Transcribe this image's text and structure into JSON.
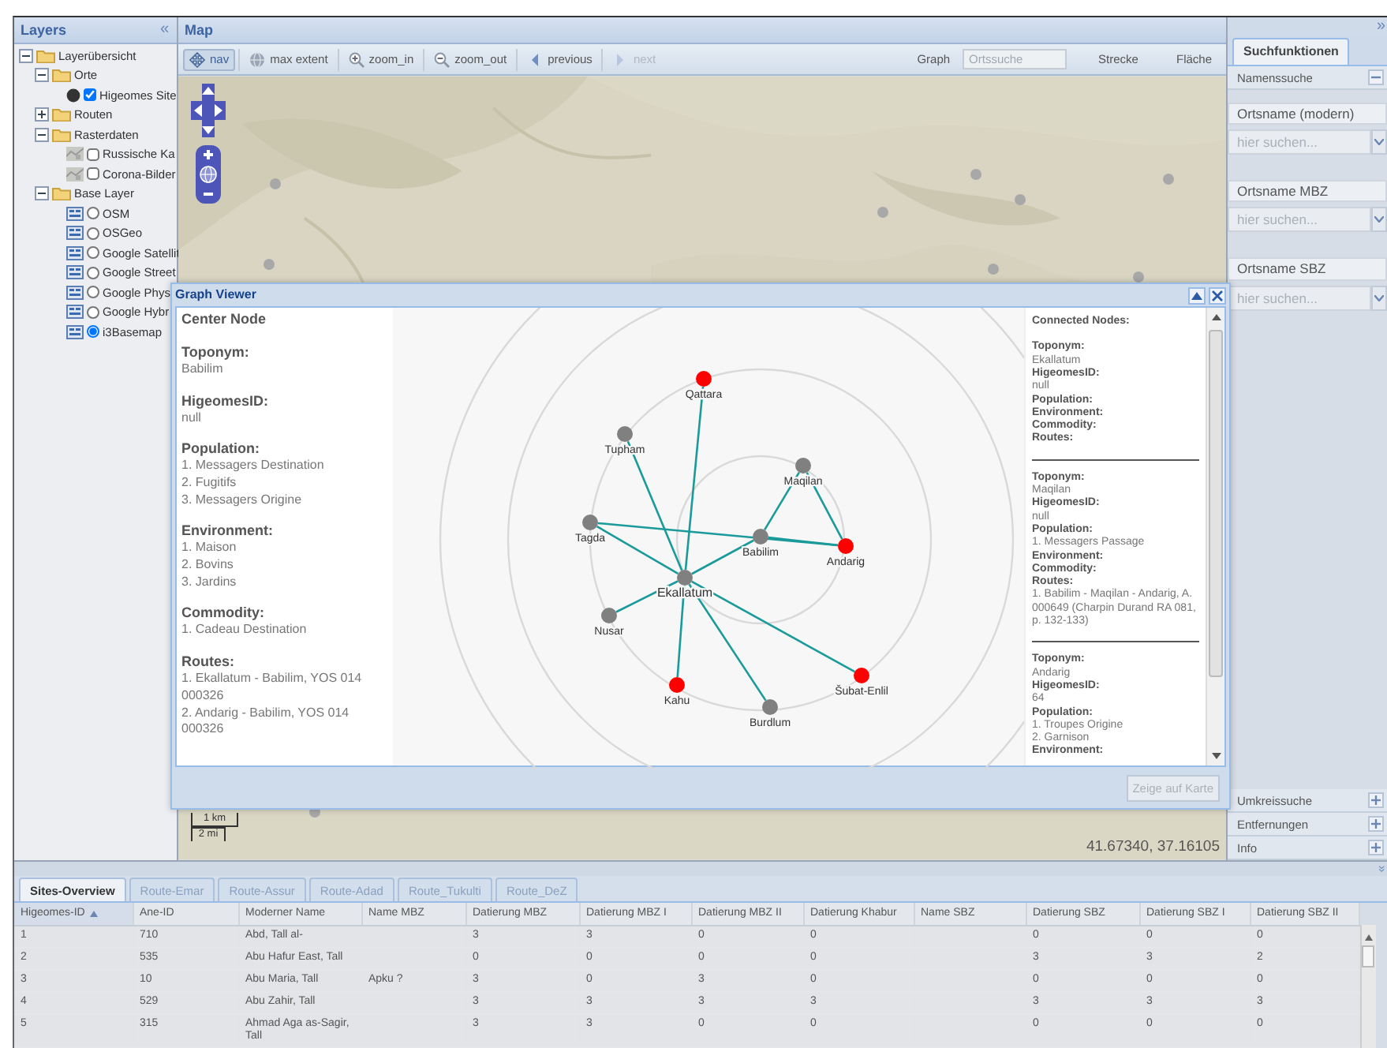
{
  "layers_panel": {
    "title": "Layers",
    "collapse_icon": "«",
    "tree": [
      {
        "label": "Layerübersicht",
        "kind": "folder",
        "expanded": true,
        "children": [
          {
            "label": "Orte",
            "kind": "folder",
            "expanded": true,
            "children": [
              {
                "label": "Higeomes Site",
                "kind": "point-layer",
                "checked": true
              }
            ]
          },
          {
            "label": "Routen",
            "kind": "folder",
            "expanded": false
          },
          {
            "label": "Rasterdaten",
            "kind": "folder",
            "expanded": true,
            "children": [
              {
                "label": "Russische Ka",
                "kind": "raster-layer",
                "checked": false
              },
              {
                "label": "Corona-Bilder",
                "kind": "raster-layer",
                "checked": false
              }
            ]
          },
          {
            "label": "Base Layer",
            "kind": "folder",
            "expanded": true,
            "children": [
              {
                "label": "OSM",
                "kind": "base-layer",
                "selected": false
              },
              {
                "label": "OSGeo",
                "kind": "base-layer",
                "selected": false
              },
              {
                "label": "Google Satellit",
                "kind": "base-layer",
                "selected": false
              },
              {
                "label": "Google Street",
                "kind": "base-layer",
                "selected": false
              },
              {
                "label": "Google Phys",
                "kind": "base-layer",
                "selected": false
              },
              {
                "label": "Google Hybr",
                "kind": "base-layer",
                "selected": false
              },
              {
                "label": "i3Basemap",
                "kind": "base-layer",
                "selected": true
              }
            ]
          }
        ]
      }
    ]
  },
  "map": {
    "title": "Map",
    "toolbar": [
      {
        "label": "nav",
        "kind": "pan",
        "pressed": true,
        "disabled": false
      },
      {
        "label": "max extent",
        "kind": "globe",
        "pressed": false,
        "disabled": false
      },
      {
        "label": "zoom_in",
        "kind": "zoom-in",
        "pressed": false,
        "disabled": false
      },
      {
        "label": "zoom_out",
        "kind": "zoom-out",
        "pressed": false,
        "disabled": false
      },
      {
        "label": "previous",
        "kind": "previous",
        "pressed": false,
        "disabled": false
      },
      {
        "label": "next",
        "kind": "next",
        "pressed": false,
        "disabled": true
      }
    ],
    "graph_label": "Graph",
    "search": {
      "placeholder": "Ortssuche"
    },
    "tools": [
      "Strecke",
      "Fläche"
    ],
    "scale_bar": [
      "1 km",
      "2 mi"
    ],
    "coordinates": "41.67340, 37.16105"
  },
  "search_panel": {
    "collapse_icon": "»",
    "tabs": [
      {
        "label": "Suchfunktionen",
        "selected": true
      }
    ],
    "sections": [
      {
        "title": "Namenssuche",
        "expanded": true,
        "fields": [
          {
            "label": "Ortsname (modern)",
            "placeholder": "hier suchen..."
          },
          {
            "label": "Ortsname MBZ",
            "placeholder": "hier suchen..."
          },
          {
            "label": "Ortsname SBZ",
            "placeholder": "hier suchen..."
          }
        ]
      },
      {
        "title": "Umkreissuche",
        "expanded": false
      },
      {
        "title": "Entfernungen",
        "expanded": false
      },
      {
        "title": "Info",
        "expanded": false
      }
    ]
  },
  "graph_viewer": {
    "title": "Graph Viewer",
    "center_node": {
      "heading": "Center Node",
      "fields": [
        {
          "label": "Toponym:",
          "lines": [
            "Babilim"
          ]
        },
        {
          "label": "HigeomesID:",
          "lines": [
            "null"
          ]
        },
        {
          "label": "Population:",
          "lines": [
            "1. Messagers Destination",
            "2. Fugitifs",
            "3. Messagers Origine"
          ]
        },
        {
          "label": "Environment:",
          "lines": [
            "1. Maison",
            "2. Bovins",
            "3. Jardins"
          ]
        },
        {
          "label": "Commodity:",
          "lines": [
            "1. Cadeau Destination"
          ]
        },
        {
          "label": "Routes:",
          "lines": [
            "1. Ekallatum - Babilim, YOS 014 000326",
            "2. Andarig - Babilim, YOS 014 000326"
          ]
        }
      ]
    },
    "graph": {
      "nodes": [
        {
          "label": "Qattara",
          "color": "#ff0000"
        },
        {
          "label": "Tupham",
          "color": "#808080"
        },
        {
          "label": "Maqilan",
          "color": "#808080"
        },
        {
          "label": "Tagda",
          "color": "#808080"
        },
        {
          "label": "Babilim",
          "color": "#808080"
        },
        {
          "label": "Andarig",
          "color": "#ff0000"
        },
        {
          "label": "Ekallatum",
          "color": "#808080"
        },
        {
          "label": "Nusar",
          "color": "#808080"
        },
        {
          "label": "Kahu",
          "color": "#ff0000"
        },
        {
          "label": "Burdlum",
          "color": "#808080"
        },
        {
          "label": "Šubat-Enlil",
          "color": "#ff0000"
        }
      ]
    },
    "connected_nodes": {
      "heading": "Connected Nodes:",
      "entries": [
        {
          "fields": [
            {
              "label": "Toponym:",
              "lines": [
                "Ekallatum"
              ]
            },
            {
              "label": "HigeomesID:",
              "lines": [
                "null"
              ]
            },
            {
              "label": "Population:"
            },
            {
              "label": "Environment:"
            },
            {
              "label": "Commodity:"
            },
            {
              "label": "Routes:"
            }
          ]
        },
        {
          "fields": [
            {
              "label": "Toponym:",
              "lines": [
                "Maqilan"
              ]
            },
            {
              "label": "HigeomesID:",
              "lines": [
                "null"
              ]
            },
            {
              "label": "Population:",
              "lines": [
                "1. Messagers Passage"
              ]
            },
            {
              "label": "Environment:"
            },
            {
              "label": "Commodity:"
            },
            {
              "label": "Routes:",
              "lines": [
                "1. Babilim - Maqilan - Andarig, A. 000649 (Charpin Durand RA 081, p. 132-133)"
              ]
            }
          ]
        },
        {
          "fields": [
            {
              "label": "Toponym:",
              "lines": [
                "Andarig"
              ]
            },
            {
              "label": "HigeomesID:",
              "lines": [
                "64"
              ]
            },
            {
              "label": "Population:",
              "lines": [
                "1. Troupes Origine",
                "2. Garnison"
              ]
            },
            {
              "label": "Environment:"
            }
          ]
        }
      ]
    },
    "footer_button": {
      "label": "Zeige auf Karte",
      "disabled": true
    }
  },
  "bottom_panel": {
    "collapse_icon": "»",
    "tabs": [
      {
        "label": "Sites-Overview",
        "selected": true
      },
      {
        "label": "Route-Emar",
        "selected": false
      },
      {
        "label": "Route-Assur",
        "selected": false
      },
      {
        "label": "Route-Adad",
        "selected": false
      },
      {
        "label": "Route_Tukulti",
        "selected": false
      },
      {
        "label": "Route_DeZ",
        "selected": false
      }
    ],
    "table": {
      "columns": [
        {
          "label": "Higeomes-ID",
          "sorted": true
        },
        {
          "label": "Ane-ID",
          "sorted": false
        },
        {
          "label": "Moderner Name",
          "sorted": false
        },
        {
          "label": "Name MBZ",
          "sorted": false
        },
        {
          "label": "Datierung MBZ",
          "sorted": false
        },
        {
          "label": "Datierung MBZ I",
          "sorted": false
        },
        {
          "label": "Datierung MBZ II",
          "sorted": false
        },
        {
          "label": "Datierung Khabur",
          "sorted": false
        },
        {
          "label": "Name SBZ",
          "sorted": false
        },
        {
          "label": "Datierung SBZ",
          "sorted": false
        },
        {
          "label": "Datierung SBZ I",
          "sorted": false
        },
        {
          "label": "Datierung SBZ II",
          "sorted": false
        }
      ],
      "rows": [
        [
          "1",
          "710",
          "Abd, Tall al-",
          null,
          "3",
          "3",
          "0",
          "0",
          null,
          "0",
          "0",
          "0"
        ],
        [
          "2",
          "535",
          "Abu Hafur East, Tall",
          null,
          "0",
          "0",
          "0",
          "0",
          null,
          "3",
          "3",
          "2"
        ],
        [
          "3",
          "10",
          "Abu Maria, Tall",
          "Apku ?",
          "3",
          "0",
          "3",
          "0",
          null,
          "0",
          "0",
          "0"
        ],
        [
          "4",
          "529",
          "Abu Zahir, Tall",
          null,
          "3",
          "3",
          "3",
          "3",
          null,
          "3",
          "3",
          "3"
        ],
        [
          "5",
          "315",
          "Ahmad Aga as-Sagir, Tall",
          null,
          "3",
          "3",
          "0",
          "0",
          null,
          "0",
          "0",
          "0"
        ]
      ]
    }
  }
}
